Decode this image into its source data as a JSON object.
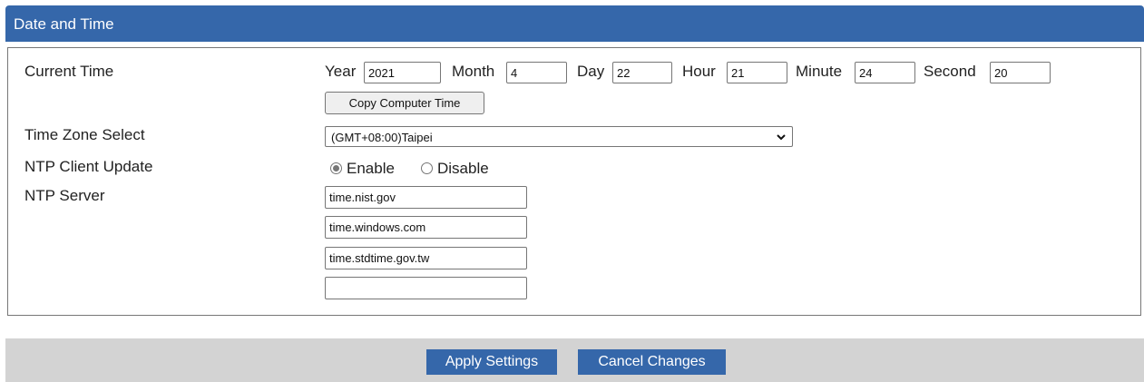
{
  "header": {
    "title": "Date and Time"
  },
  "current_time": {
    "label": "Current Time",
    "year_label": "Year",
    "year": "2021",
    "month_label": "Month",
    "month": "4",
    "day_label": "Day",
    "day": "22",
    "hour_label": "Hour",
    "hour": "21",
    "minute_label": "Minute",
    "minute": "24",
    "second_label": "Second",
    "second": "20",
    "copy_button": "Copy Computer Time"
  },
  "time_zone": {
    "label": "Time Zone Select",
    "selected": "(GMT+08:00)Taipei"
  },
  "ntp_client": {
    "label": "NTP Client Update",
    "enable": "Enable",
    "disable": "Disable",
    "selected": "Enable"
  },
  "ntp_server": {
    "label": "NTP Server",
    "servers": [
      "time.nist.gov",
      "time.windows.com",
      "time.stdtime.gov.tw",
      ""
    ]
  },
  "footer": {
    "apply": "Apply Settings",
    "cancel": "Cancel Changes"
  },
  "colors": {
    "header": "#3567aa",
    "footer_bg": "#d3d3d3",
    "button": "#3567aa"
  }
}
